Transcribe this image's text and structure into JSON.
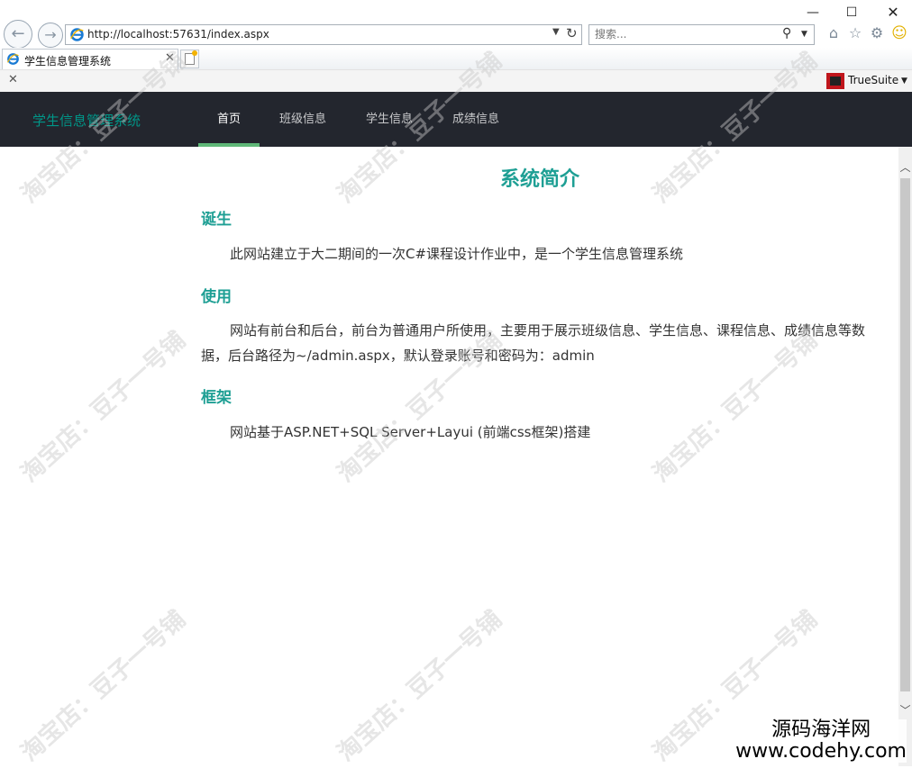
{
  "window_controls": {
    "minimize": "—",
    "maximize": "☐",
    "close": "✕"
  },
  "browser": {
    "url": "http://localhost:57631/index.aspx",
    "search_placeholder": "搜索...",
    "tab_title": "学生信息管理系统",
    "truesuite_label": "TrueSuite"
  },
  "app": {
    "logo": "学生信息管理系统",
    "nav": [
      {
        "label": "首页"
      },
      {
        "label": "班级信息"
      },
      {
        "label": "学生信息"
      },
      {
        "label": "成绩信息"
      }
    ]
  },
  "content": {
    "heading": "系统简介",
    "sections": [
      {
        "title": "诞生",
        "text": "此网站建立于大二期间的一次C#课程设计作业中，是一个学生信息管理系统"
      },
      {
        "title": "使用",
        "text": "网站有前台和后台，前台为普通用户所使用，主要用于展示班级信息、学生信息、课程信息、成绩信息等数据，后台路径为~/admin.aspx，默认登录账号和密码为：admin"
      },
      {
        "title": "框架",
        "text": "网站基于ASP.NET+SQL Server+Layui (前端css框架)搭建"
      }
    ]
  },
  "watermark": {
    "text": "淘宝店：豆子一号铺",
    "corner_cn": "源码海洋网",
    "corner_url": "www.codehy.com"
  },
  "colors": {
    "nav_bg": "#23262e",
    "accent": "#009688",
    "heading": "#1e9f94",
    "nav_active_bar": "#5fb878"
  }
}
